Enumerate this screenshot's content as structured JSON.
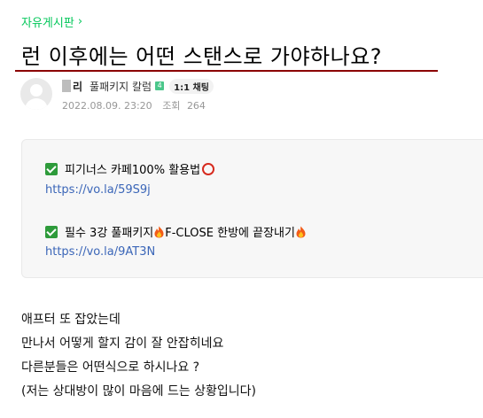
{
  "breadcrumb": {
    "board": "자유게시판",
    "chevron": "›"
  },
  "post": {
    "title": "런 이후에는 어떤 스탠스로 가야하나요?",
    "author": {
      "name": "리",
      "grade": "풀패키지 칼럼",
      "grade_badge": "4",
      "chat_badge": "1:1 채팅"
    },
    "date": "2022.08.09. 23:20",
    "views_label": "조회",
    "views": "264"
  },
  "notice": {
    "items": [
      {
        "text": "피기너스 카페100% 활용법",
        "link": "https://vo.la/59S9j",
        "icon": "check-icon",
        "trail_icon": "ring-icon"
      },
      {
        "text_before": "필수 3강 풀패키지",
        "text_middle": "F-CLOSE 한방에 끝장내기",
        "link": "https://vo.la/9AT3N",
        "icon": "check-icon",
        "trail_icon": "fire-icon"
      }
    ]
  },
  "body": {
    "lines": [
      "애프터 또 잡았는데",
      "만나서 어떻게 할지 감이 잘 안잡히네요",
      "다른분들은 어떤식으로 하시나요 ?",
      "(저는 상대방이 많이 마음에 드는 상황입니다)"
    ]
  },
  "colors": {
    "accent_green": "#03c75a",
    "link_blue": "#3b66b8",
    "title_underline": "#8b0000"
  }
}
